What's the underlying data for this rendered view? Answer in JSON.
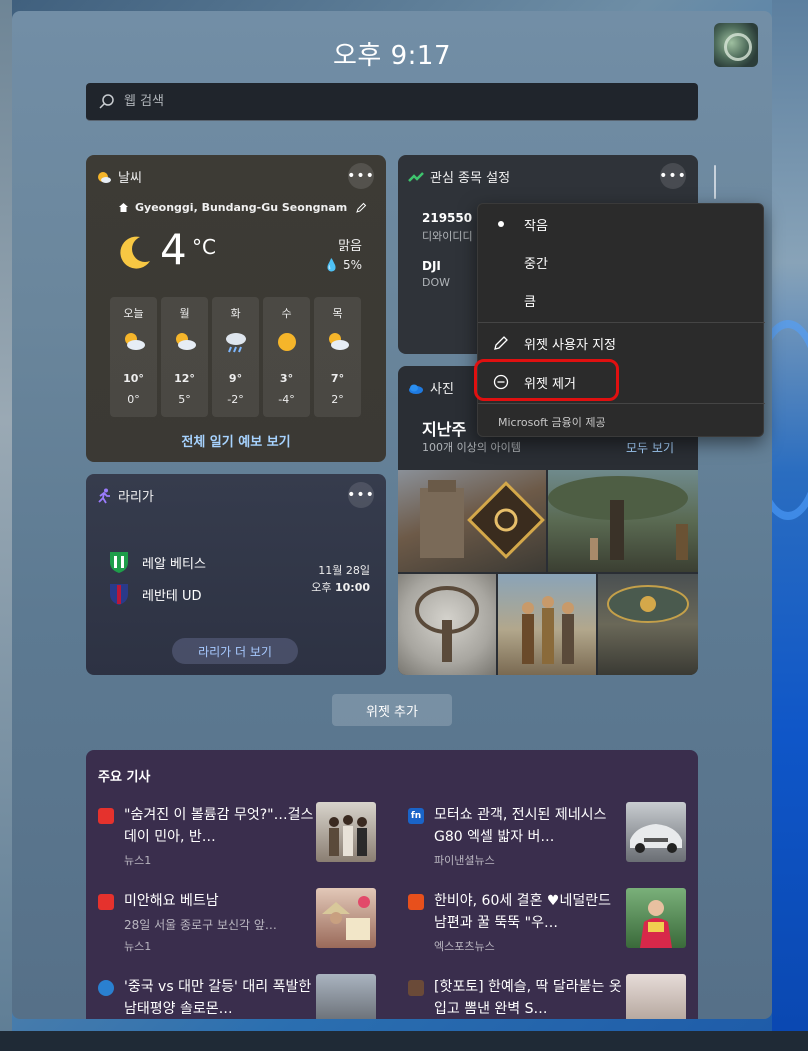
{
  "header": {
    "time": "오후 9:17"
  },
  "search": {
    "placeholder": "웹 검색"
  },
  "weather": {
    "title": "날씨",
    "location": "Gyeonggi, Bundang-Gu Seongnam",
    "temp": "4",
    "unit": "°C",
    "condition": "맑음",
    "precip": "5%",
    "forecast": [
      {
        "day": "오늘",
        "icon": "partly-cloudy-icon",
        "hi": "10°",
        "lo": "0°"
      },
      {
        "day": "월",
        "icon": "partly-cloudy-icon",
        "hi": "12°",
        "lo": "5°"
      },
      {
        "day": "화",
        "icon": "rain-icon",
        "hi": "9°",
        "lo": "-2°"
      },
      {
        "day": "수",
        "icon": "sunny-icon",
        "hi": "3°",
        "lo": "-4°"
      },
      {
        "day": "목",
        "icon": "partly-cloudy-icon",
        "hi": "7°",
        "lo": "2°"
      }
    ],
    "link": "전체 일기 예보 보기"
  },
  "stocks": {
    "title": "관심 종목 설정",
    "items": [
      {
        "symbol": "219550",
        "name": "디와이디디"
      },
      {
        "symbol": "DJI",
        "name": "DOW"
      }
    ]
  },
  "photos": {
    "title": "사진",
    "heading": "지난주",
    "subtitle": "100개 이상의 아이템",
    "see_all": "모두 보기"
  },
  "laliga": {
    "title": "라리가",
    "home_team": "레알 베티스",
    "away_team": "레반테 UD",
    "date": "11월 28일",
    "time_prefix": "오후",
    "time": "10:00",
    "button": "라리가 더 보기"
  },
  "add_widget": "위젯 추가",
  "news": {
    "heading": "주요 기사",
    "articles": [
      {
        "headline": "\"숨겨진 이 볼륨감 무엇?\"…걸스데이 민아, 반…",
        "snippet": "",
        "source": "뉴스1",
        "src_color": "#e5322d"
      },
      {
        "headline": "모터쇼 관객, 전시된 제네시스 G80 엑셀 밟자 버…",
        "snippet": "",
        "source": "파이낸셜뉴스",
        "src_color": "#1a64c8"
      },
      {
        "headline": "미안해요 베트남",
        "snippet": "28일 서울 종로구 보신각 앞…",
        "source": "뉴스1",
        "src_color": "#e5322d"
      },
      {
        "headline": "한비야, 60세 결혼 ♥네덜란드 남편과 꿀 뚝뚝 \"우…",
        "snippet": "",
        "source": "엑스포츠뉴스",
        "src_color": "#e8501c"
      },
      {
        "headline": "'중국 vs 대만 갈등' 대리 폭발한 남태평양 솔로몬…",
        "snippet": "",
        "source": "",
        "src_color": "#2a80d0"
      },
      {
        "headline": "[핫포토] 한예슬, 딱 달라붙는 옷입고 뽐낸 완벽 S…",
        "snippet": "",
        "source": "",
        "src_color": "#6a4a38"
      }
    ]
  },
  "menu": {
    "items": [
      "작음",
      "중간",
      "큼"
    ],
    "selected": "작음",
    "customize": "위젯 사용자 지정",
    "remove": "위젯 제거",
    "footer": "Microsoft 금융이 제공"
  },
  "colors": {
    "accent": "#a7d3ff",
    "highlight": "#e01010"
  }
}
